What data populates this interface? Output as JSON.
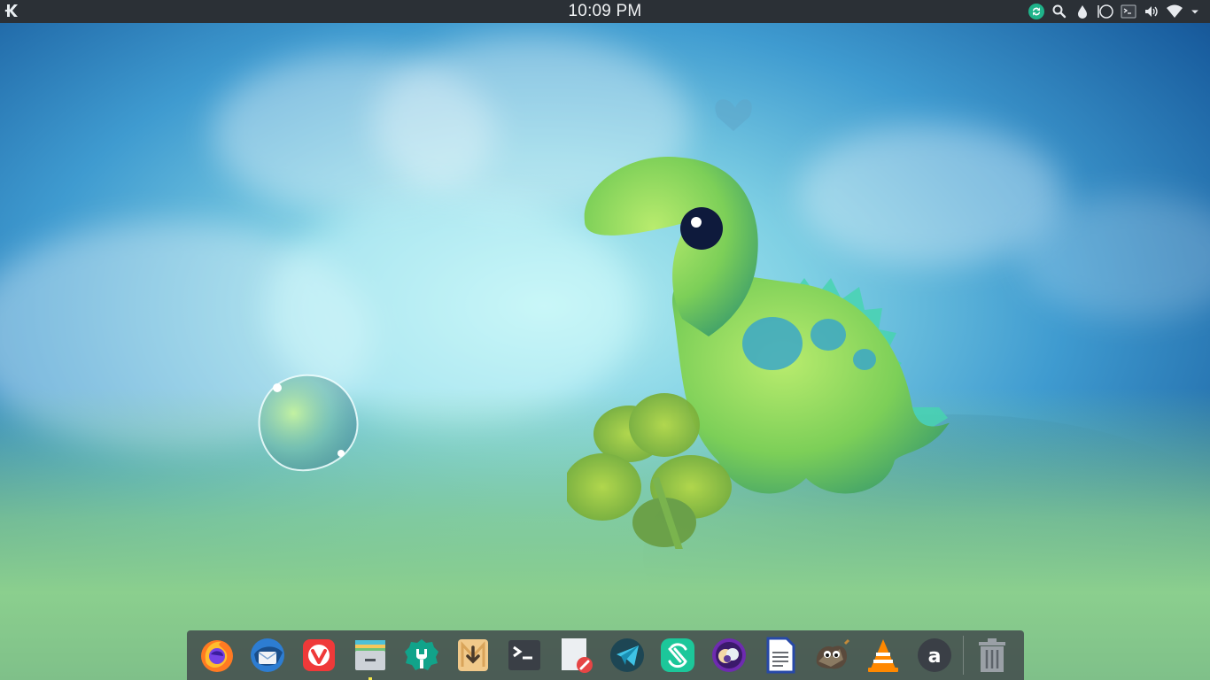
{
  "top_panel": {
    "clock": "10:09 PM",
    "launcher_icon": "kde-logo-icon",
    "tray": [
      {
        "name": "sync-icon",
        "color": "#1fb38a"
      },
      {
        "name": "search-icon"
      },
      {
        "name": "droplet-icon"
      },
      {
        "name": "circle-icon"
      },
      {
        "name": "terminal-icon"
      },
      {
        "name": "volume-icon"
      },
      {
        "name": "wifi-icon"
      },
      {
        "name": "chevron-down-icon"
      }
    ]
  },
  "dock": {
    "items": [
      {
        "name": "firefox-icon",
        "running": false
      },
      {
        "name": "thunderbird-icon",
        "running": false
      },
      {
        "name": "vivaldi-icon",
        "running": false
      },
      {
        "name": "file-manager-icon",
        "running": true
      },
      {
        "name": "settings-wrench-icon",
        "running": false
      },
      {
        "name": "downloader-icon",
        "running": false
      },
      {
        "name": "terminal-icon",
        "running": false
      },
      {
        "name": "text-editor-icon",
        "running": false
      },
      {
        "name": "telegram-icon",
        "running": false
      },
      {
        "name": "element-icon",
        "running": false
      },
      {
        "name": "media-player-icon",
        "running": false
      },
      {
        "name": "document-writer-icon",
        "running": false
      },
      {
        "name": "gimp-icon",
        "running": false
      },
      {
        "name": "vlc-icon",
        "running": false
      },
      {
        "name": "appimage-icon",
        "running": false
      }
    ],
    "trash": {
      "name": "trash-icon"
    }
  },
  "colors": {
    "panel_bg": "#2b3036",
    "dock_bg": "#3c4046",
    "accent": "#f6e94b"
  }
}
